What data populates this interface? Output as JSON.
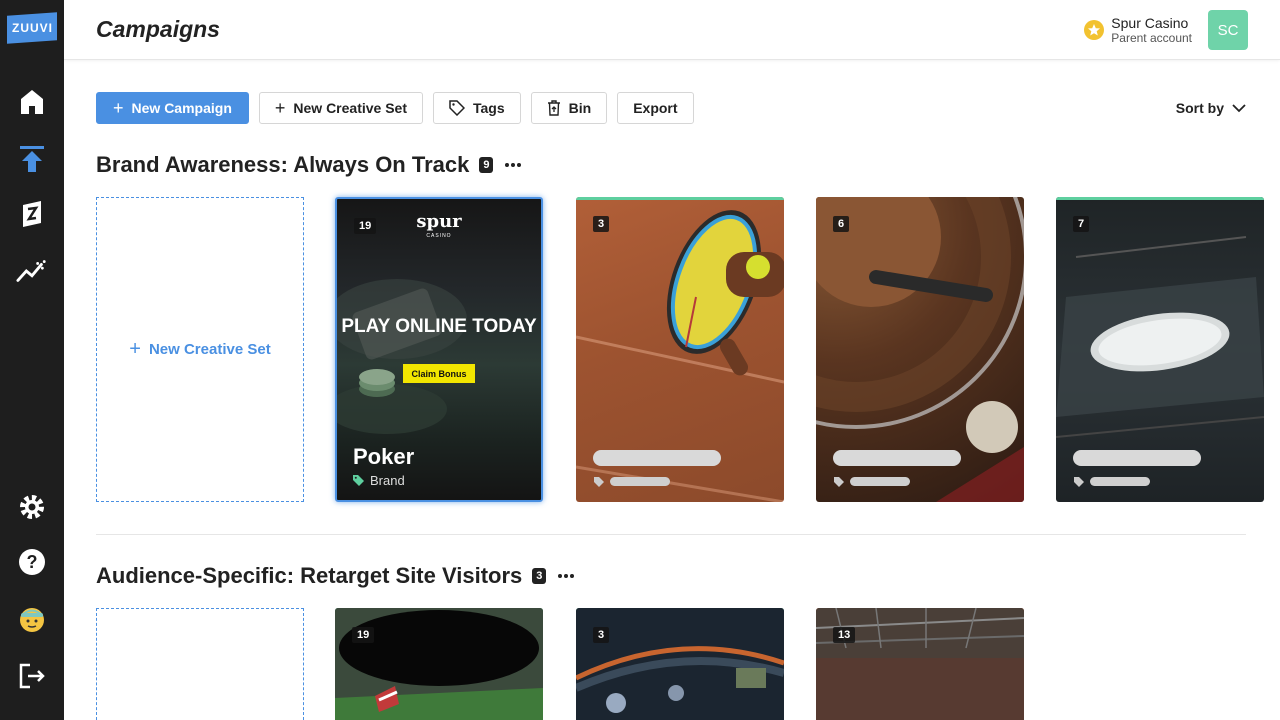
{
  "app": {
    "logo_text": "ZUUVI",
    "page_title": "Campaigns"
  },
  "sidebar": {
    "items": [
      {
        "icon": "home-icon"
      },
      {
        "icon": "upload-icon"
      },
      {
        "icon": "brand-z-icon"
      },
      {
        "icon": "analytics-icon"
      },
      {
        "icon": "settings-icon"
      },
      {
        "icon": "help-icon"
      },
      {
        "icon": "emoji-avatar-icon"
      },
      {
        "icon": "logout-icon"
      }
    ]
  },
  "account": {
    "name": "Spur Casino",
    "role": "Parent account",
    "avatar_initials": "SC",
    "avatar_color": "#6fd3a9"
  },
  "toolbar": {
    "new_campaign": "New Campaign",
    "new_creative_set": "New Creative Set",
    "tags": "Tags",
    "bin": "Bin",
    "export": "Export",
    "sort_by": "Sort by"
  },
  "colors": {
    "accent": "#4a90e2",
    "sidebar_bg": "#1e1e1e",
    "topline_green": "#5ecf9f",
    "topline_orange": "#e0643a"
  },
  "sections": [
    {
      "title": "Brand Awareness: Always On Track",
      "count": "9",
      "new_set_label": "New Creative Set",
      "cards": [
        {
          "count": "19",
          "selected": true,
          "brand": "spur",
          "brand_sub": "CASINO",
          "headline": "PLAY ONLINE TODAY",
          "cta": "Claim Bonus",
          "title": "Poker",
          "tag": "Brand"
        },
        {
          "count": "3",
          "topline": "green",
          "image": "tennis-racket-photo"
        },
        {
          "count": "6",
          "topline": "none",
          "image": "roulette-wheel-photo"
        },
        {
          "count": "7",
          "topline": "green",
          "image": "ice-hockey-arena-photo"
        }
      ]
    },
    {
      "title": "Audience-Specific: Retarget Site Visitors",
      "count": "3",
      "cards": [
        {
          "count": "19",
          "topline": "green",
          "image": "football-stadium-photo"
        },
        {
          "count": "3",
          "topline": "green",
          "image": "stadium-lights-photo"
        },
        {
          "count": "13",
          "topline": "orange",
          "image": "stadium-crowd-photo"
        }
      ]
    }
  ]
}
